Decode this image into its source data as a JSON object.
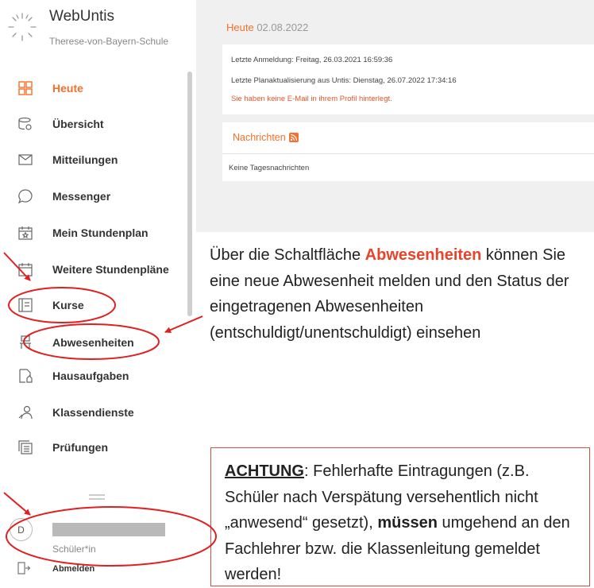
{
  "brand": {
    "name": "WebUntis",
    "school": "Therese-von-Bayern-Schule"
  },
  "nav": [
    {
      "label": "Heute",
      "icon": "today-grid-icon",
      "active": true
    },
    {
      "label": "Übersicht",
      "icon": "overview-icon"
    },
    {
      "label": "Mitteilungen",
      "icon": "mail-icon"
    },
    {
      "label": "Messenger",
      "icon": "chat-bubble-icon"
    },
    {
      "label": "Mein Stundenplan",
      "icon": "calendar-star-icon"
    },
    {
      "label": "Weitere Stundenpläne",
      "icon": "calendar-icon"
    },
    {
      "label": "Kurse",
      "icon": "courses-icon"
    },
    {
      "label": "Abwesenheiten",
      "icon": "chair-icon"
    },
    {
      "label": "Hausaufgaben",
      "icon": "homework-icon"
    },
    {
      "label": "Klassendienste",
      "icon": "class-duty-icon"
    },
    {
      "label": "Prüfungen",
      "icon": "exams-icon"
    }
  ],
  "user": {
    "avatar_letter": "D",
    "role": "Schüler*in"
  },
  "logout_label": "Abmelden",
  "today": {
    "heading": "Heute",
    "date": "02.08.2022",
    "last_login": "Letzte Anmeldung: Freitag, 26.03.2021 16:59:36",
    "last_update": "Letzte Planaktualisierung aus Untis: Dienstag, 26.07.2022 17:34:16",
    "warning": "Sie haben keine E-Mail in ihrem Profil hinterlegt."
  },
  "news": {
    "title": "Nachrichten",
    "empty": "Keine Tagesnachrichten"
  },
  "annotation": {
    "p1_pre": "Über die Schaltfläche ",
    "p1_highlight": "Abwesenheiten",
    "p1_post": " können Sie eine neue Abwesenheit melden und den Status der eingetragenen Abwesenheiten (entschuldigt/unentschuldigt) einsehen",
    "warn_label": "ACHTUNG",
    "warn_pre": ": Fehlerhafte Eintragungen (z.B. Schüler nach Verspätung versehentlich nicht „anwesend“ gesetzt), ",
    "warn_bold": "müssen",
    "warn_post": " umgehend an den Fachlehrer bzw. die Klassenleitung gemeldet werden!"
  },
  "colors": {
    "accent": "#f5702c",
    "annotation_red": "#e8432b",
    "main_bg": "#f0f0f0"
  }
}
